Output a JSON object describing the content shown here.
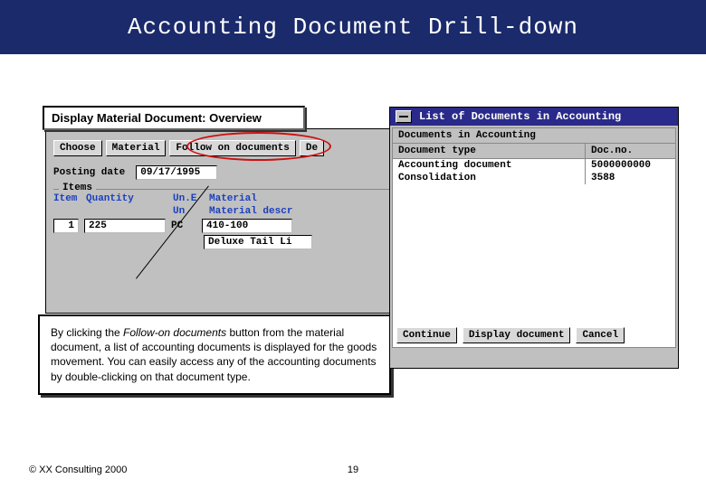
{
  "slide": {
    "title": "Accounting Document Drill-down",
    "footer": "© XX Consulting 2000",
    "page_number": "19"
  },
  "sap_window": {
    "title": "Display Material Document: Overview",
    "toolbar": {
      "choose": "Choose",
      "material": "Material",
      "follow_on": "Follow on documents",
      "details": "De"
    },
    "posting": {
      "label": "Posting date",
      "value": "09/17/1995"
    },
    "items": {
      "group_label": "Items",
      "headers": {
        "item": "Item",
        "quantity": "Quantity",
        "une": "Un.E",
        "material": "Material",
        "un": "Un",
        "material_descr": "Material descr"
      },
      "row": {
        "item": "1",
        "quantity": "225",
        "uom": "PC",
        "material": "410-100",
        "material_descr": "Deluxe Tail Li"
      }
    }
  },
  "list_window": {
    "title": "List of Documents in Accounting",
    "section": "Documents in Accounting",
    "cols": {
      "type": "Document type",
      "docno": "Doc.no."
    },
    "rows": [
      {
        "type": "Accounting document",
        "docno": "5000000000"
      },
      {
        "type": "Consolidation",
        "docno": "3588"
      }
    ],
    "buttons": {
      "continue": "Continue",
      "display": "Display document",
      "cancel": "Cancel"
    }
  },
  "explanation": {
    "pre": "By clicking the ",
    "em": "Follow-on documents",
    "post": " button from the material document, a list of accounting documents is displayed for the goods movement.  You can easily access any of the accounting documents by double-clicking on that document type."
  }
}
